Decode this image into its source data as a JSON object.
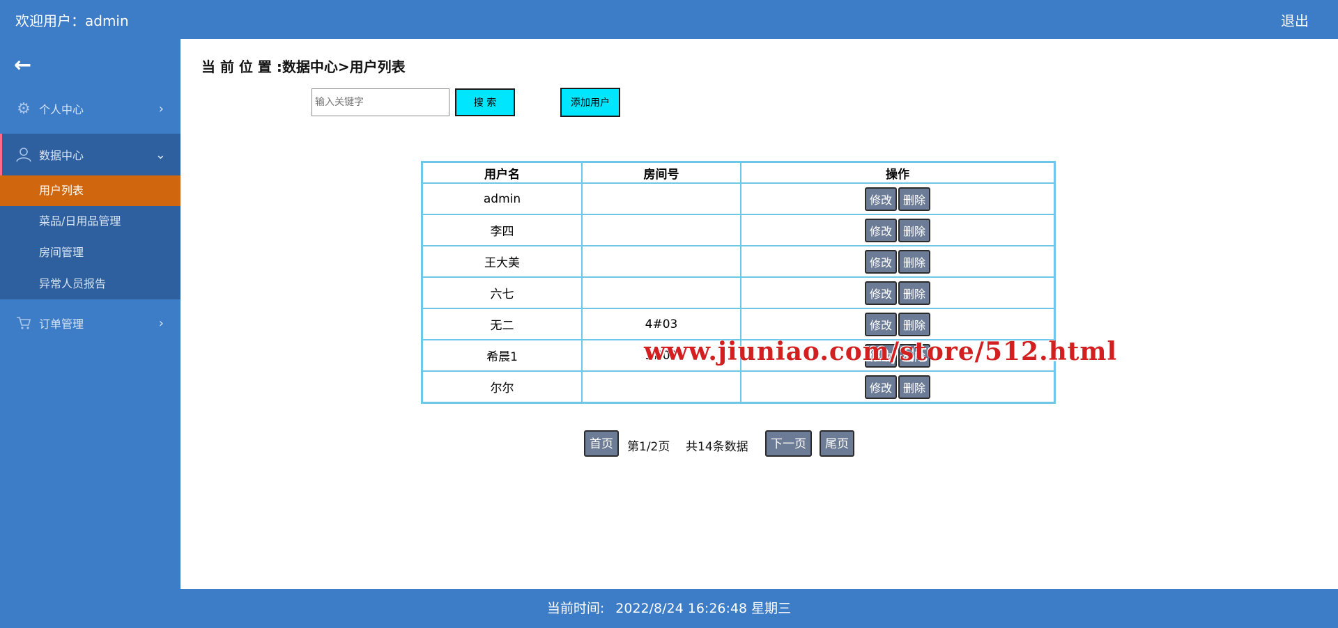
{
  "header": {
    "welcome": "欢迎用户：admin",
    "logout": "退出"
  },
  "sidebar": {
    "back": "←",
    "personal": {
      "label": "个人中心",
      "icon": "gear-icon"
    },
    "data_center": {
      "label": "数据中心",
      "icon": "user-icon"
    },
    "sub_items": [
      {
        "label": "用户列表",
        "active": true
      },
      {
        "label": "菜品/日用品管理"
      },
      {
        "label": "房间管理"
      },
      {
        "label": "异常人员报告"
      }
    ],
    "orders": {
      "label": "订单管理",
      "icon": "cart-icon"
    }
  },
  "main": {
    "breadcrumb": "当 前 位 置 :数据中心>用户列表",
    "search": {
      "placeholder": "输入关键字",
      "button": "搜 索"
    },
    "add_button": "添加用户",
    "table": {
      "headers": [
        "用户名",
        "房间号",
        "操作"
      ],
      "rows": [
        {
          "username": "admin",
          "room": ""
        },
        {
          "username": "李四",
          "room": ""
        },
        {
          "username": "王大美",
          "room": ""
        },
        {
          "username": "六七",
          "room": ""
        },
        {
          "username": "无二",
          "room": "4#03"
        },
        {
          "username": "希晨1",
          "room": "3#01"
        },
        {
          "username": "尔尔",
          "room": ""
        }
      ],
      "edit_label": "修改",
      "delete_label": "删除"
    },
    "pager": {
      "first": "首页",
      "page_info": "第1/2页",
      "total": "共14条数据",
      "next": "下一页",
      "last": "尾页"
    },
    "watermark": "www.jiuniao.com/store/512.html"
  },
  "footer": {
    "label": "当前时间:",
    "time": "2022/8/24 16:26:48 星期三"
  }
}
